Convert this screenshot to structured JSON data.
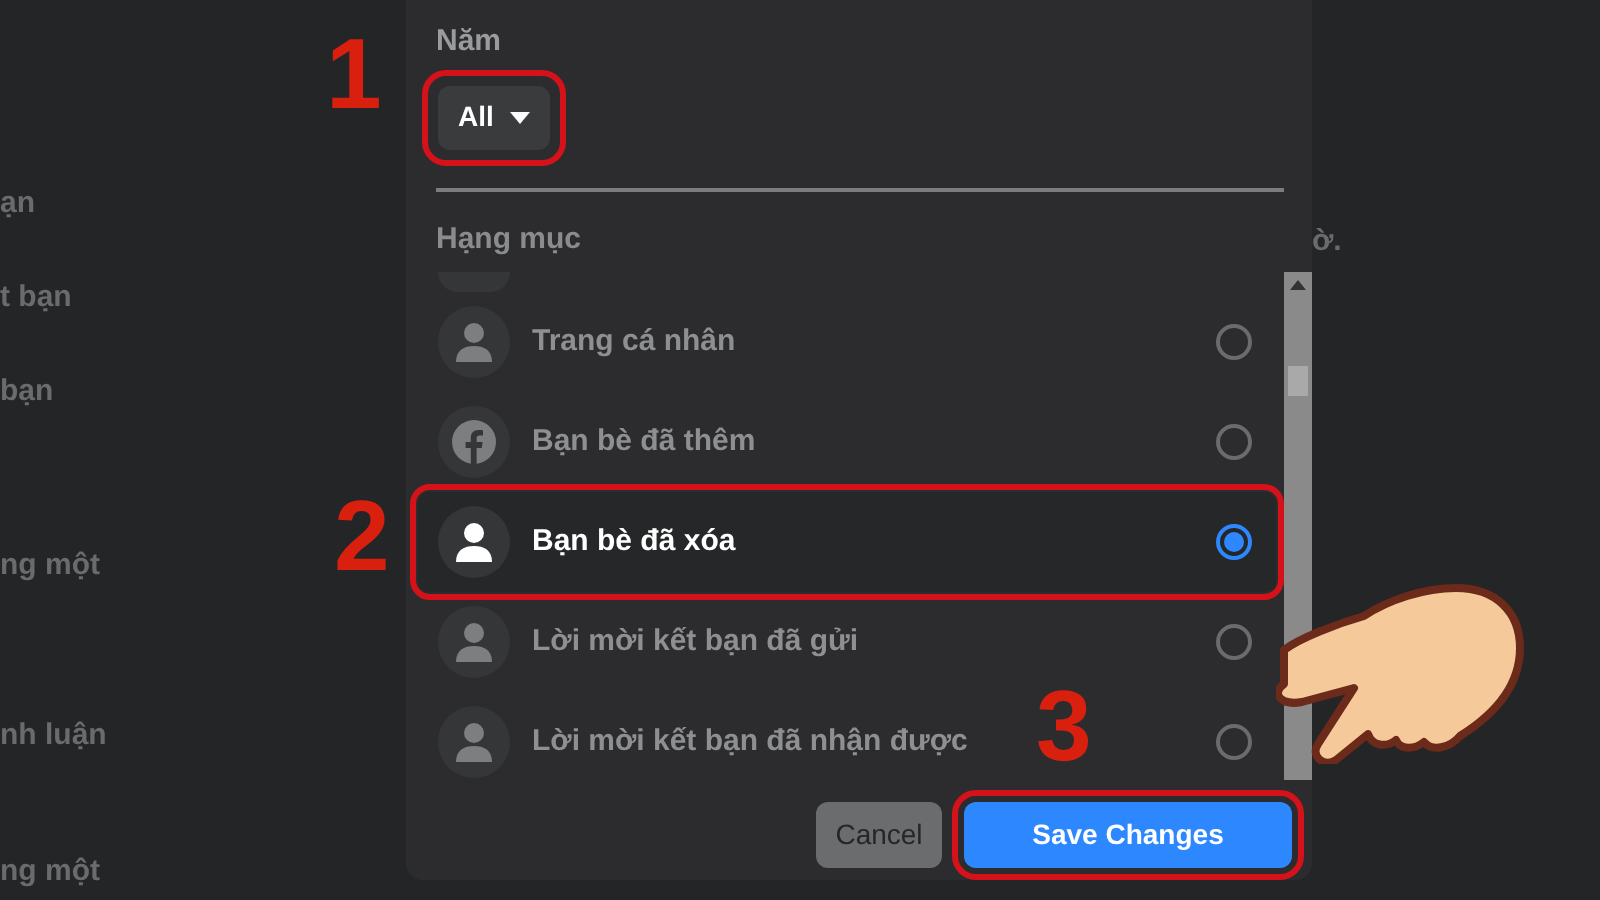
{
  "background_left": [
    "ạn",
    "t bạn",
    "bạn",
    "ng một",
    "nh luận",
    "ng một"
  ],
  "background_right": "ờ.",
  "dialog": {
    "year": {
      "label": "Năm",
      "value": "All",
      "highlighted": true
    },
    "category": {
      "label": "Hạng mục",
      "items": [
        {
          "label": "Trang cá nhân",
          "kind": "person",
          "selected": false,
          "highlighted": false
        },
        {
          "label": "Bạn bè đã thêm",
          "kind": "facebook",
          "selected": false,
          "highlighted": false
        },
        {
          "label": "Bạn bè đã xóa",
          "kind": "person",
          "selected": true,
          "highlighted": true
        },
        {
          "label": "Lời mời kết bạn đã gửi",
          "kind": "person",
          "selected": false,
          "highlighted": false
        },
        {
          "label": "Lời mời kết bạn đã nhận được",
          "kind": "person",
          "selected": false,
          "highlighted": false
        }
      ]
    },
    "buttons": [
      {
        "label": "Cancel",
        "kind": "secondary",
        "highlighted": false
      },
      {
        "label": "Save Changes",
        "kind": "primary",
        "highlighted": true
      }
    ]
  },
  "annotations": [
    "1",
    "2",
    "3"
  ]
}
